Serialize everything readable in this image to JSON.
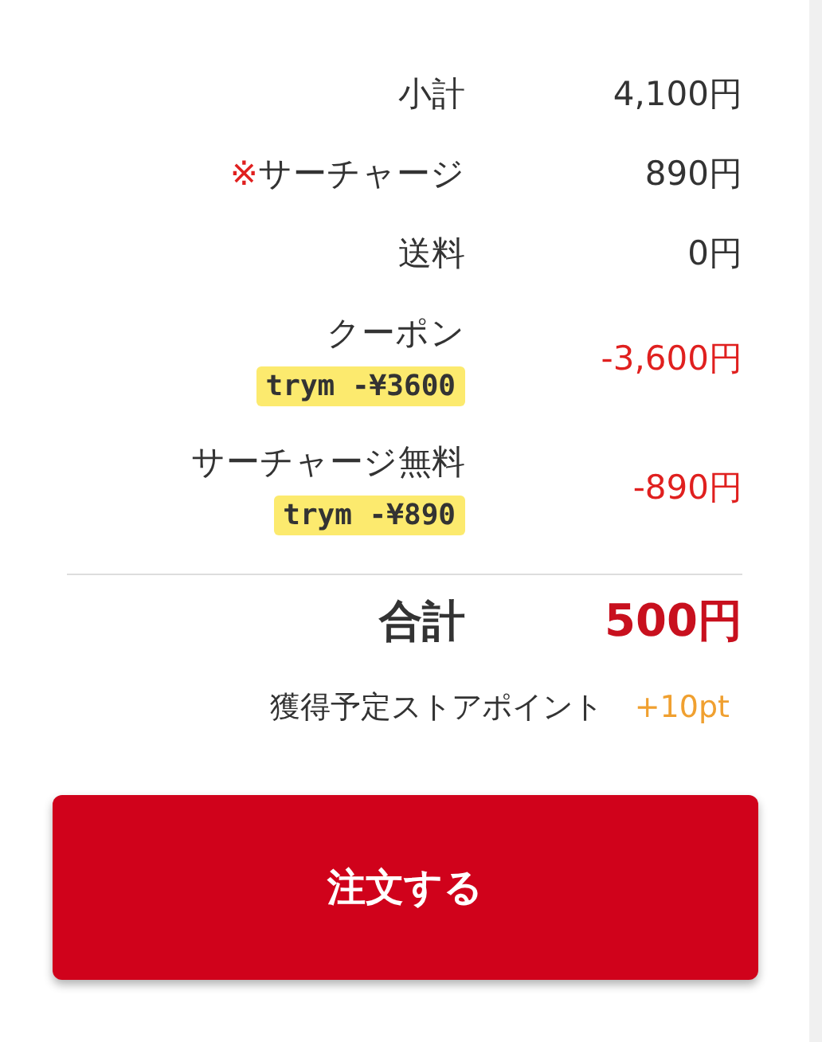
{
  "rows": [
    {
      "kind": "plain",
      "label": "小計",
      "value": "4,100円"
    },
    {
      "kind": "plain",
      "mark": "※",
      "label": "サーチャージ",
      "value": "890円"
    },
    {
      "kind": "plain",
      "label": "送料",
      "value": "0円"
    },
    {
      "kind": "discount",
      "label": "クーポン",
      "code": "trym -¥3600",
      "value": "-3,600円"
    },
    {
      "kind": "discount",
      "label": "サーチャージ無料",
      "code": "trym -¥890",
      "value": "-890円"
    }
  ],
  "total": {
    "label": "合計",
    "value": "500円"
  },
  "points": {
    "label": "獲得予定ストアポイント",
    "value": "+10pt"
  },
  "order_button": "注文する"
}
